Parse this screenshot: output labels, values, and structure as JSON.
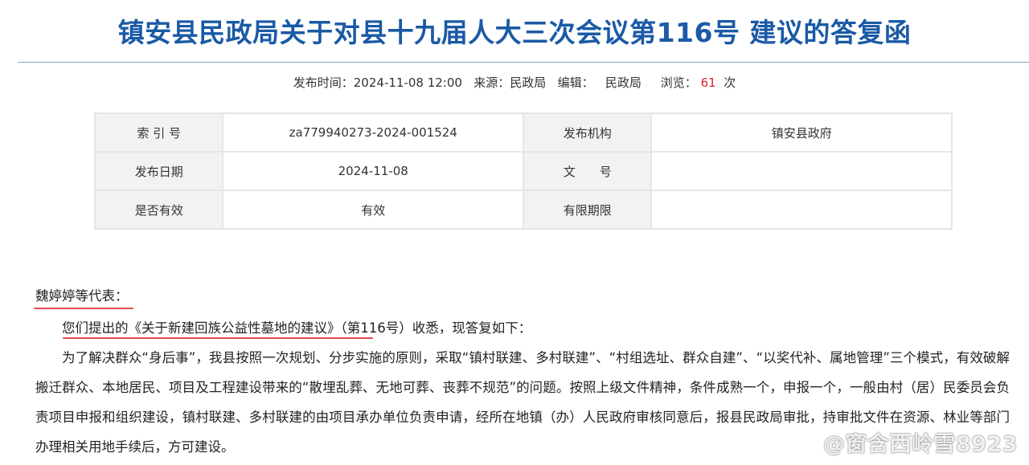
{
  "document": {
    "title": "镇安县民政局关于对县十九届人大三次会议第116号 建议的答复函",
    "meta": {
      "publish_time_label": "发布时间：",
      "publish_time": "2024-11-08 12:00",
      "source_label": "来源：",
      "source": "民政局",
      "editor_label": "编辑：",
      "editor": "民政局",
      "views_label": "浏览：",
      "views": "61",
      "views_unit": "次"
    },
    "info_table": {
      "rows": [
        [
          "索 引 号",
          "za779940273-2024-001524",
          "发布机构",
          "镇安县政府"
        ],
        [
          "发布日期",
          "2024-11-08",
          "文　　号",
          ""
        ],
        [
          "是否有效",
          "有效",
          "有限期限",
          ""
        ]
      ]
    },
    "salutation": "魏婷婷等代表：",
    "paragraphs": [
      "您们提出的《关于新建回族公益性墓地的建议》（第116号）收悉，现答复如下：",
      "为了解决群众“身后事”，我县按照一次规划、分步实施的原则，采取“镇村联建、多村联建”、“村组选址、群众自建”、“以奖代补、属地管理”三个模式，有效破解搬迁群众、本地居民、项目及工程建设带来的“散埋乱葬、无地可葬、丧葬不规范”的问题。按照上级文件精神，条件成熟一个，申报一个，一般由村（居）民委员会负责项目申报和组织建设，镇村联建、多村联建的由项目承办单位负责申请，经所在地镇（办）人民政府审核同意后，报县民政局审批，持审批文件在资源、林业等部门办理相关用地手续后，方可建设。"
    ]
  },
  "watermark": {
    "icon": "weibo-icon",
    "text": "@窗含西岭雪8923"
  },
  "colors": {
    "title": "#1a5aa6",
    "views": "#d9232d",
    "underline": "#e04a55"
  }
}
